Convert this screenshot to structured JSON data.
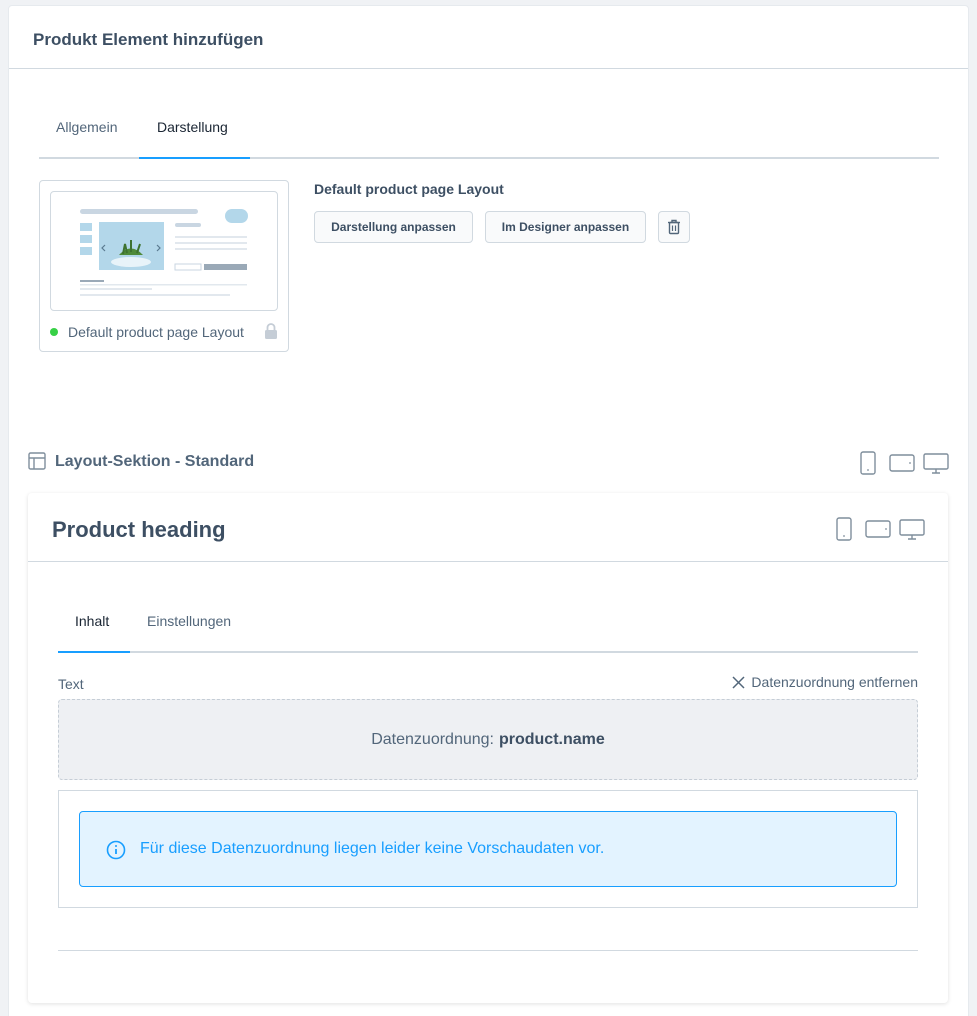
{
  "modal": {
    "title": "Produkt Element hinzufügen",
    "tabs": [
      {
        "label": "Allgemein",
        "active": false
      },
      {
        "label": "Darstellung",
        "active": true
      }
    ]
  },
  "layout": {
    "thumb_name": "Default product page Layout",
    "status_color": "#37d046",
    "name": "Default product page Layout",
    "buttons": {
      "customize_label": "Darstellung anpassen",
      "designer_label": "Im Designer anpassen",
      "delete_icon": "trash-icon"
    }
  },
  "section": {
    "title": "Layout-Sektion - Standard",
    "icon": "layout-section-icon",
    "devices": [
      "mobile-icon",
      "tablet-icon",
      "desktop-icon"
    ]
  },
  "element": {
    "title": "Product heading",
    "devices": [
      "mobile-icon",
      "tablet-icon",
      "desktop-icon"
    ],
    "tabs": [
      {
        "label": "Inhalt",
        "active": true
      },
      {
        "label": "Einstellungen",
        "active": false
      }
    ],
    "field": {
      "label": "Text",
      "remove_mapping_label": "Datenzuordnung entfernen",
      "mapping_prefix": "Datenzuordnung:",
      "mapping_value": "product.name"
    },
    "info": {
      "message": "Für diese Datenzuordnung liegen leider keine Vorschaudaten vor."
    }
  },
  "colors": {
    "accent": "#189eff",
    "text": "#52667a",
    "heading": "#3d4f63",
    "info_bg": "#e3f3ff",
    "success": "#37d046"
  }
}
